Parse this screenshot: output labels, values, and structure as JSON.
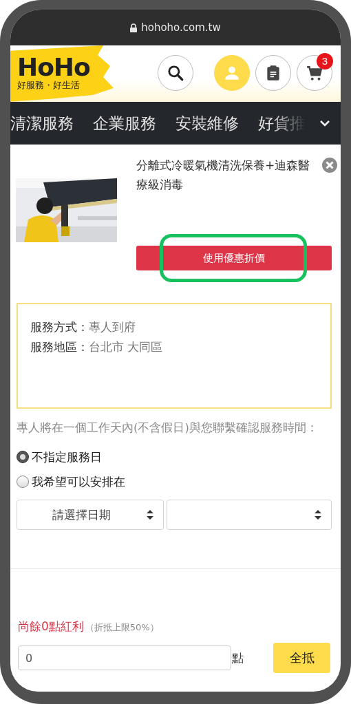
{
  "browser": {
    "url": "hohoho.com.tw"
  },
  "header": {
    "logo": {
      "wordmark": "HoHo",
      "tagline": "好服務・好生活"
    },
    "buttons": [
      {
        "kind": "search",
        "active": false
      },
      {
        "kind": "user",
        "active": true
      },
      {
        "kind": "orders",
        "active": false
      },
      {
        "kind": "cart",
        "active": false,
        "badge": "3"
      }
    ]
  },
  "nav": {
    "items": [
      "清潔服務",
      "企業服務",
      "安裝維修",
      "好貨推"
    ]
  },
  "product": {
    "title": "分離式冷暖氣機清洗保養+迪森醫療級消毒",
    "coupon_button": "使用優惠折價",
    "highlighted": true
  },
  "service": {
    "rows": [
      {
        "label": "服務方式：",
        "value": "專人到府"
      },
      {
        "label": "服務地區：",
        "value": "台北市 大同區"
      }
    ]
  },
  "schedule": {
    "note": "專人將在一個工作天內(不含假日)與您聯繫確認服務時間：",
    "options": [
      {
        "label": "不指定服務日",
        "selected": true
      },
      {
        "label": "我希望可以安排在",
        "selected": false
      }
    ],
    "date_select": "請選擇日期"
  },
  "bonus": {
    "balance": "尚餘0點紅利",
    "limit": "（折抵上限50%）",
    "value": "0",
    "unit": "點",
    "button": "全抵"
  }
}
